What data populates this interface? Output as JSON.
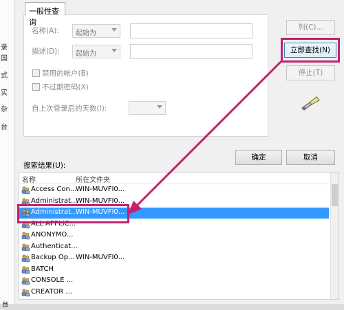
{
  "dialog": {
    "tab_label": "一般性查询",
    "name_label": "名称(A):",
    "desc_label": "描述(D):",
    "name_match": "起始为",
    "desc_match": "起始为",
    "disabled_accounts": "禁用的帐户(B)",
    "no_expire_password": "不过期密码(X)",
    "days_since_logon": "自上次登录后的天数(I):"
  },
  "buttons": {
    "columns": "列(C)...",
    "find_now": "立即查找(N)",
    "stop": "停止(T)",
    "ok": "确定",
    "cancel": "取消"
  },
  "results": {
    "label": "搜索结果(U):",
    "columns": [
      "名称",
      "所在文件夹"
    ],
    "rows": [
      {
        "name": "Access Con...",
        "folder": "WIN-MUVFI0..."
      },
      {
        "name": "Administrat...",
        "folder": "WIN-MUVFI0..."
      },
      {
        "name": "Administrat...",
        "folder": "WIN-MUVFI0...",
        "selected": true
      },
      {
        "name": "ALL APPLIC...",
        "folder": ""
      },
      {
        "name": "ANONYMO...",
        "folder": ""
      },
      {
        "name": "Authenticat...",
        "folder": ""
      },
      {
        "name": "Backup Op...",
        "folder": "WIN-MUVFI0..."
      },
      {
        "name": "BATCH",
        "folder": ""
      },
      {
        "name": "CONSOLE ...",
        "folder": ""
      },
      {
        "name": "CREATOR ...",
        "folder": ""
      }
    ]
  },
  "left_strip": [
    "录",
    "国",
    "式",
    "实",
    "杂",
    "台"
  ],
  "bottom_text": "目",
  "colors": {
    "highlight": "#c3206d",
    "selection": "#3399ff"
  }
}
